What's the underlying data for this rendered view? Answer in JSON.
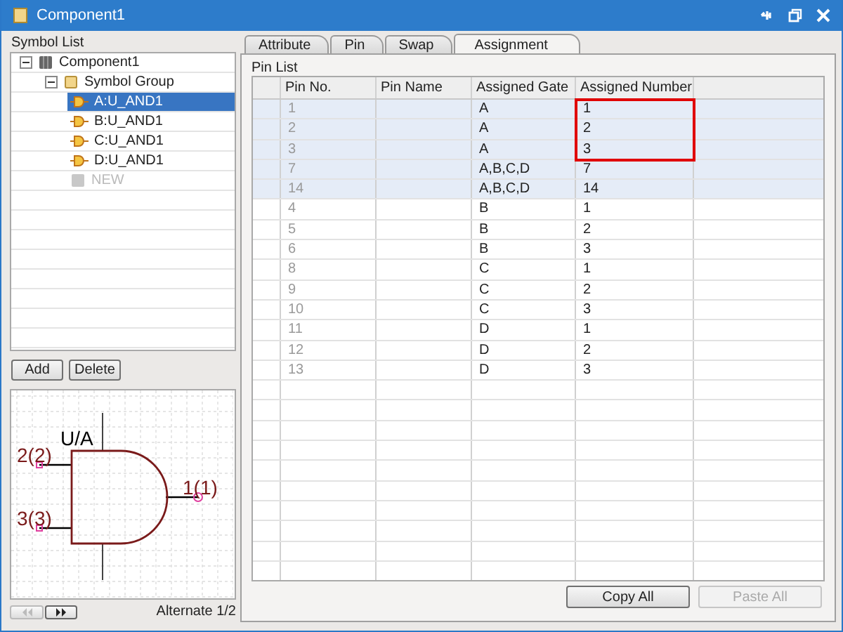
{
  "window": {
    "title": "Component1"
  },
  "symbol_list": {
    "label": "Symbol List",
    "items": [
      {
        "kind": "component",
        "label": "Component1",
        "expanded": true,
        "selected": false,
        "children": [
          {
            "kind": "group",
            "label": "Symbol Group",
            "expanded": true,
            "selected": false,
            "children": [
              {
                "kind": "symbol",
                "label": "A:U_AND1",
                "selected": true,
                "disabled": false
              },
              {
                "kind": "symbol",
                "label": "B:U_AND1",
                "selected": false,
                "disabled": false
              },
              {
                "kind": "symbol",
                "label": "C:U_AND1",
                "selected": false,
                "disabled": false
              },
              {
                "kind": "symbol",
                "label": "D:U_AND1",
                "selected": false,
                "disabled": false
              },
              {
                "kind": "new",
                "label": "NEW",
                "selected": false,
                "disabled": true
              }
            ]
          }
        ]
      }
    ]
  },
  "list_buttons": [
    {
      "label": "Add"
    },
    {
      "label": "Delete"
    }
  ],
  "preview": {
    "gate_label": "U/A",
    "pins": [
      {
        "label": "2(2)"
      },
      {
        "label": "3(3)"
      },
      {
        "label": "1(1)"
      }
    ],
    "alternate": "Alternate 1/2"
  },
  "tabs": [
    {
      "label": "Attribute",
      "selected": false
    },
    {
      "label": "Pin",
      "selected": false
    },
    {
      "label": "Swap",
      "selected": false
    },
    {
      "label": "Assignment",
      "selected": true
    }
  ],
  "pin_list": {
    "label": "Pin List",
    "columns": [
      "Pin No.",
      "Pin Name",
      "Assigned Gate",
      "Assigned Number"
    ],
    "rows": [
      {
        "pin_no": "1",
        "gate": "A",
        "number": "1",
        "selected": true,
        "outlined": true
      },
      {
        "pin_no": "2",
        "gate": "A",
        "number": "2",
        "selected": true,
        "outlined": true
      },
      {
        "pin_no": "3",
        "gate": "A",
        "number": "3",
        "selected": true,
        "outlined": true
      },
      {
        "pin_no": "7",
        "gate": "A,B,C,D",
        "number": "7",
        "selected": true,
        "outlined": false
      },
      {
        "pin_no": "14",
        "gate": "A,B,C,D",
        "number": "14",
        "selected": true,
        "outlined": false
      },
      {
        "pin_no": "4",
        "gate": "B",
        "number": "1",
        "selected": false,
        "outlined": false
      },
      {
        "pin_no": "5",
        "gate": "B",
        "number": "2",
        "selected": false,
        "outlined": false
      },
      {
        "pin_no": "6",
        "gate": "B",
        "number": "3",
        "selected": false,
        "outlined": false
      },
      {
        "pin_no": "8",
        "gate": "C",
        "number": "1",
        "selected": false,
        "outlined": false
      },
      {
        "pin_no": "9",
        "gate": "C",
        "number": "2",
        "selected": false,
        "outlined": false
      },
      {
        "pin_no": "10",
        "gate": "C",
        "number": "3",
        "selected": false,
        "outlined": false
      },
      {
        "pin_no": "11",
        "gate": "D",
        "number": "1",
        "selected": false,
        "outlined": false
      },
      {
        "pin_no": "12",
        "gate": "D",
        "number": "2",
        "selected": false,
        "outlined": false
      },
      {
        "pin_no": "13",
        "gate": "D",
        "number": "3",
        "selected": false,
        "outlined": false
      }
    ]
  },
  "actions": [
    {
      "label": "Copy All",
      "disabled": false
    },
    {
      "label": "Paste All",
      "disabled": true
    }
  ]
}
